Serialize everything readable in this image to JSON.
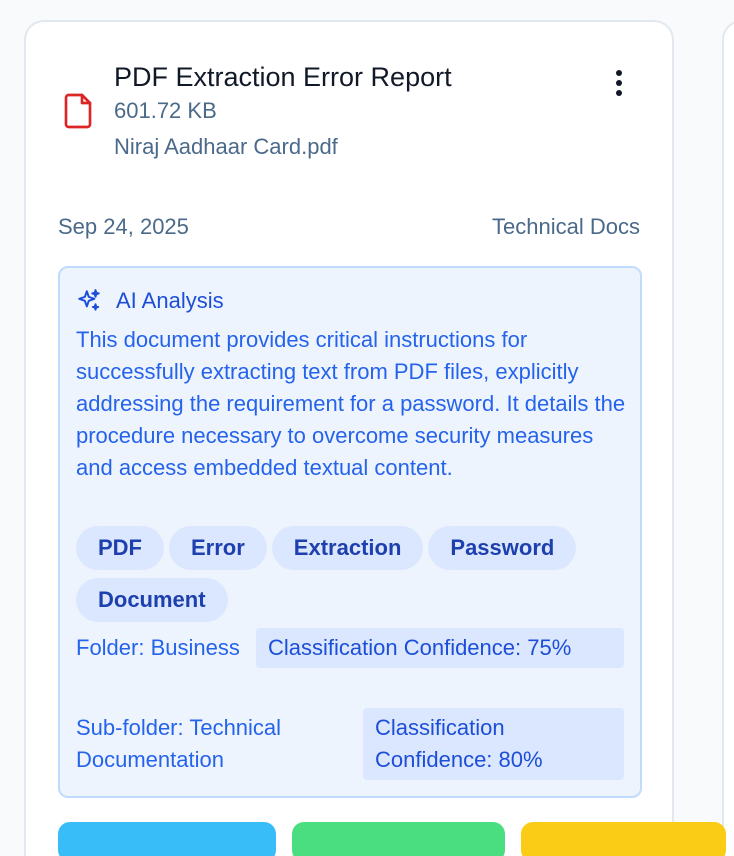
{
  "document": {
    "title": "PDF Extraction Error Report",
    "size": "601.72 KB",
    "filename": "Niraj Aadhaar Card.pdf",
    "date": "Sep 24, 2025",
    "category": "Technical Docs"
  },
  "icons": {
    "file": "file-icon",
    "menu": "more-vertical-icon",
    "ai": "sparkles-icon"
  },
  "ai_analysis": {
    "title": "AI Analysis",
    "summary": "This document provides critical instructions for successfully extracting text from PDF files, explicitly addressing the requirement for a password. It details the procedure necessary to overcome security measures and access embedded textual content.",
    "tags": [
      "PDF",
      "Error",
      "Extraction",
      "Password",
      "Document"
    ],
    "folder_label": "Folder: Business",
    "folder_confidence": "Classification Confidence: 75%",
    "subfolder_label": "Sub-folder: Technical Documentation",
    "subfolder_confidence": "Classification Confidence: 80%"
  },
  "colors": {
    "accent": "#2563eb",
    "file_icon": "#dc2626",
    "button_blue": "#38bdf8",
    "button_green": "#4ade80",
    "button_yellow": "#facc15"
  }
}
